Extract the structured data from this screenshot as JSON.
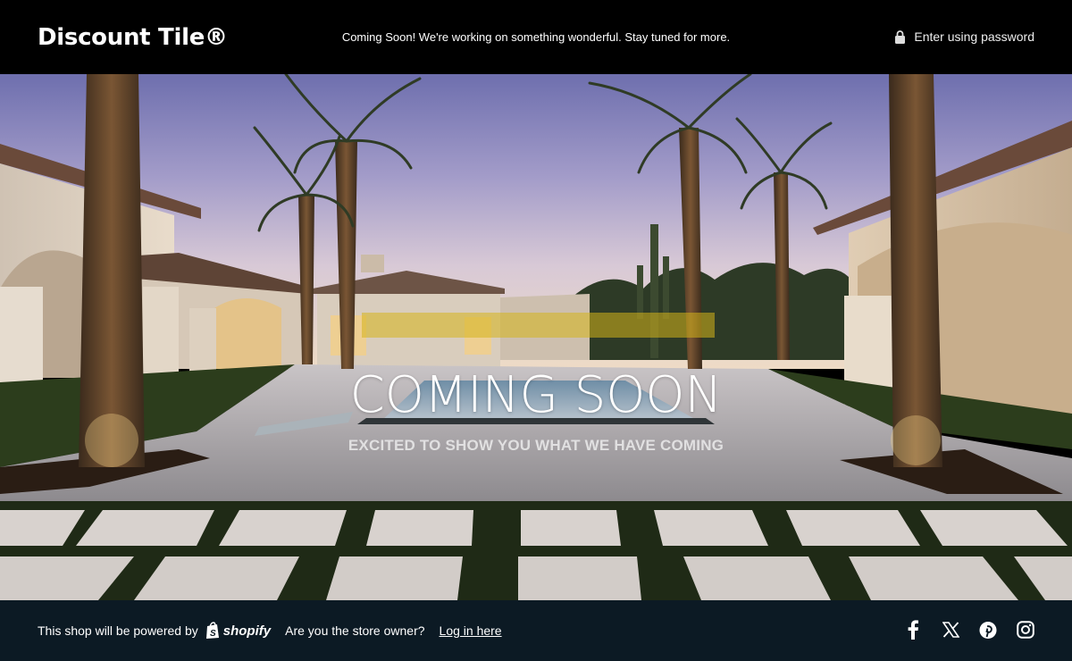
{
  "header": {
    "brand": "Discount Tile®",
    "announcement": "Coming Soon! We're working on something wonderful. Stay tuned for more.",
    "password_link": "Enter using password",
    "lock_icon": "lock-icon"
  },
  "hero": {
    "title": "COMING SOON",
    "subtitle": "EXCITED TO SHOW YOU WHAT WE HAVE COMING"
  },
  "footer": {
    "powered_by": "This shop will be powered by",
    "shopify": "shopify",
    "owner_question": "Are you the store owner?",
    "login_link": "Log in here",
    "socials": [
      "facebook-icon",
      "x-icon",
      "pinterest-icon",
      "instagram-icon"
    ],
    "background": "#0c1a24"
  }
}
